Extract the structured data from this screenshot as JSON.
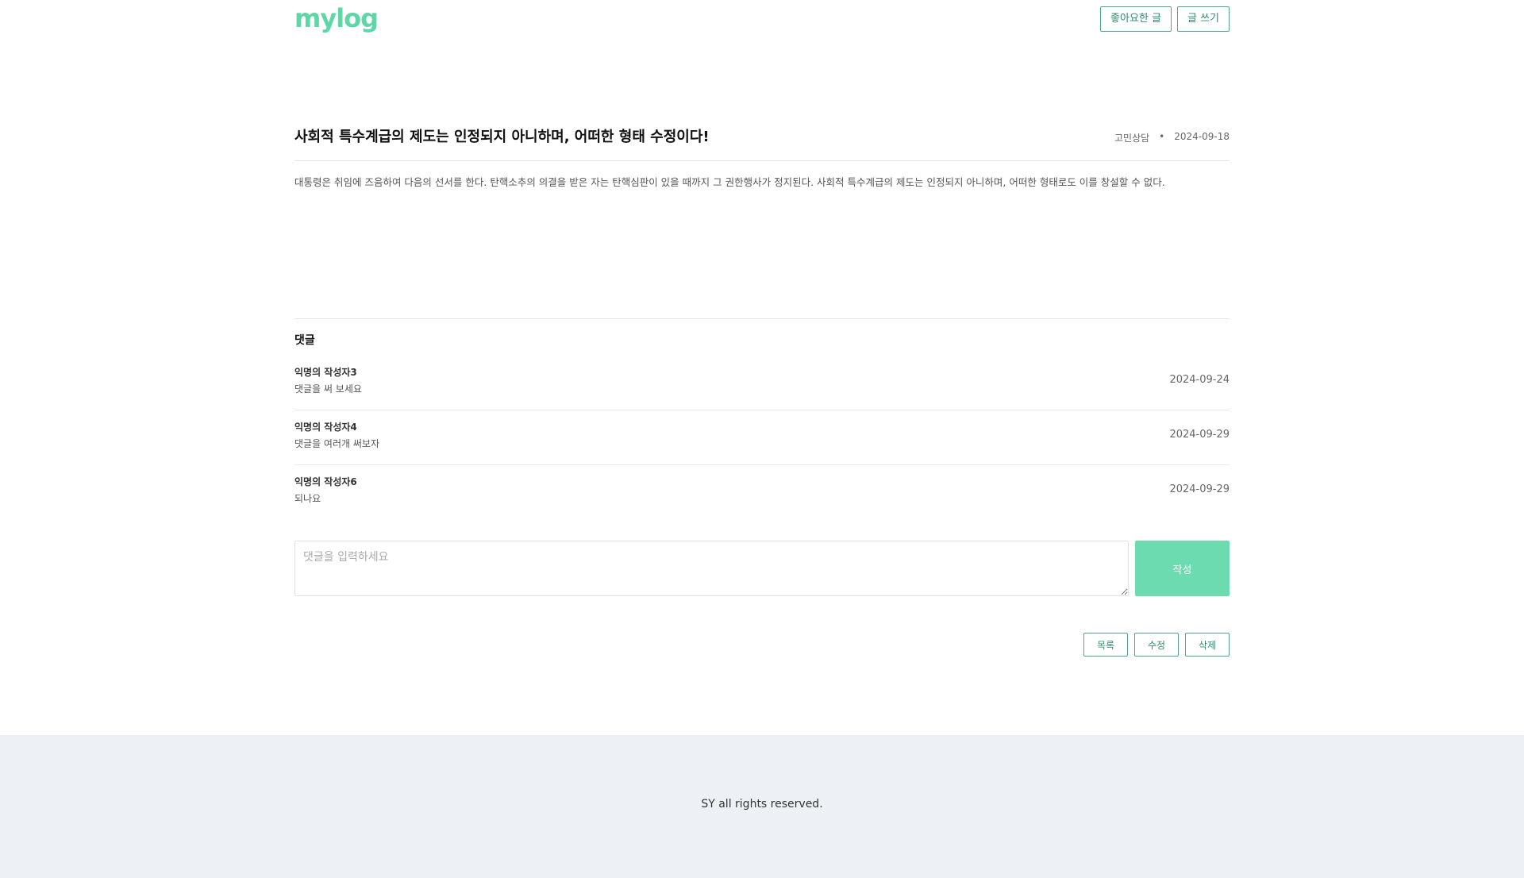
{
  "header": {
    "logo": "mylog",
    "liked_button": "좋아요한 글",
    "write_button": "글 쓰기",
    "accent_color": "#5ed6a6"
  },
  "post": {
    "title": "사회적 특수계급의 제도는 인정되지 아니하며, 어떠한 형태 수정이다!",
    "category": "고민상담",
    "separator": "•",
    "date": "2024-09-18",
    "body": "대통령은 취임에 즈음하여 다음의 선서를 한다. 탄핵소추의 의결을 받은 자는 탄핵심판이 있을 때까지 그 권한행사가 정지된다. 사회적 특수계급의 제도는 인정되지 아니하며, 어떠한 형태로도 이를 창설할 수 없다."
  },
  "comments": {
    "title": "댓글",
    "items": [
      {
        "author": "익명의 작성자3",
        "text": "댓글을 써 보세요",
        "date": "2024-09-24"
      },
      {
        "author": "익명의 작성자4",
        "text": "댓글을 여러개 써보자",
        "date": "2024-09-29"
      },
      {
        "author": "익명의 작성자6",
        "text": "되나요",
        "date": "2024-09-29"
      }
    ],
    "input_placeholder": "댓글을 입력하세요",
    "submit_label": "작성"
  },
  "actions": {
    "list_label": "목록",
    "edit_label": "수정",
    "delete_label": "삭제"
  },
  "footer": {
    "text": "SY all rights reserved."
  }
}
